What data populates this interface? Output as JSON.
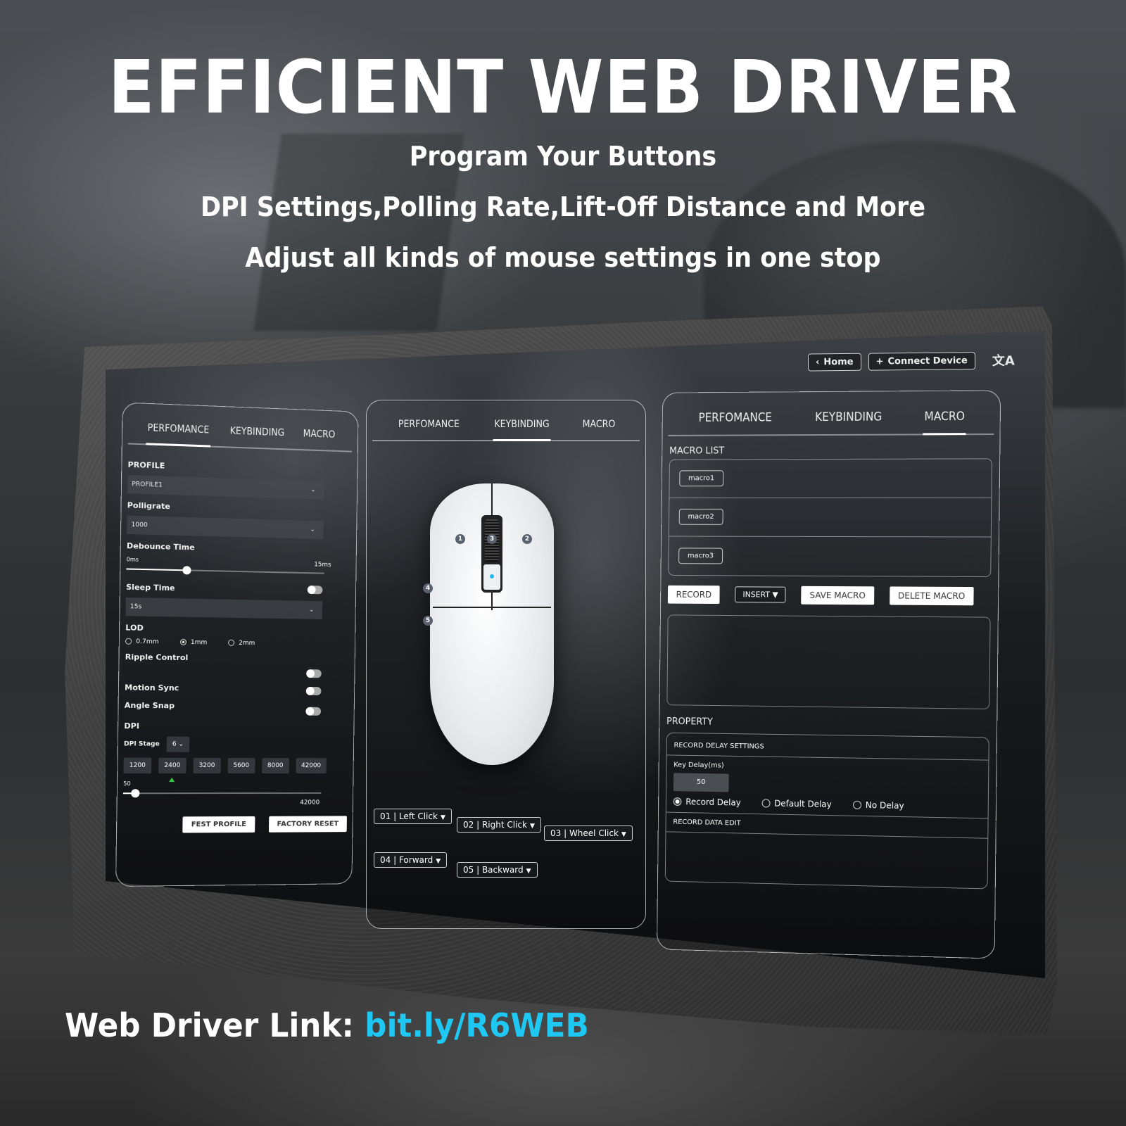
{
  "headline": "EFFICIENT WEB DRIVER",
  "subtitles": [
    "Program Your Buttons",
    "DPI Settings,Polling Rate,Lift-Off Distance and More",
    "Adjust all kinds of mouse settings in one stop"
  ],
  "topbar": {
    "home_label": "Home",
    "connect_label": "Connect Device",
    "home_icon": "chevron-left-icon",
    "connect_icon": "plus-icon",
    "language_icon": "translate-icon",
    "language_glyph": "文A"
  },
  "tabs": [
    "PERFOMANCE",
    "KEYBINDING",
    "MACRO"
  ],
  "performance": {
    "profile_label": "PROFILE",
    "profile_value": "PROFILE1",
    "pollrate_label": "Polligrate",
    "pollrate_value": "1000",
    "debounce_label": "Debounce Time",
    "debounce_min": "0ms",
    "debounce_max": "15ms",
    "debounce_fraction": 0.3,
    "sleep_label": "Sleep Time",
    "sleep_value": "15s",
    "sleep_toggle": true,
    "lod_label": "LOD",
    "lod_options": [
      "0.7mm",
      "1mm",
      "2mm"
    ],
    "lod_selected": "1mm",
    "ripple_label": "Ripple Control",
    "motion_label": "Motion Sync",
    "angle_label": "Angle Snap",
    "dpi_label": "DPI",
    "dpi_stage_label": "DPI Stage",
    "dpi_stage_value": "6",
    "dpi_values": [
      "1200",
      "2400",
      "3200",
      "5600",
      "8000",
      "42000"
    ],
    "dpi_selected": "2400",
    "dpi_slider_min": "50",
    "dpi_slider_max": "42000",
    "dpi_slider_fraction": 0.06,
    "fest_profile_label": "FEST PROFILE",
    "factory_reset_label": "FACTORY RESET"
  },
  "keybinding": {
    "mouse_badges": [
      "1",
      "2",
      "3",
      "4",
      "5"
    ],
    "buttons": [
      {
        "label": "01 | Left Click"
      },
      {
        "label": "02 | Right Click"
      },
      {
        "label": "03 | Wheel Click"
      },
      {
        "label": "04 | Forward"
      },
      {
        "label": "05 | Backward"
      }
    ]
  },
  "macro": {
    "list_label": "MACRO  LIST",
    "items": [
      "macro1",
      "macro2",
      "macro3"
    ],
    "record_label": "RECORD",
    "insert_label": "INSERT",
    "save_label": "SAVE MACRO",
    "delete_label": "DELETE MACRO",
    "property_label": "PROPERTY",
    "record_delay_settings": "RECORD DELAY SETTINGS",
    "key_delay_label": "Key Delay(ms)",
    "key_delay_value": "50",
    "delay_options": [
      "Record Delay",
      "Default Delay",
      "No Delay"
    ],
    "delay_selected": "Record Delay",
    "record_data_edit": "RECORD DATA EDIT"
  },
  "footer": {
    "label": "Web Driver Link: ",
    "link": "bit.ly/R6WEB",
    "link_color": "#1ec8f2"
  }
}
